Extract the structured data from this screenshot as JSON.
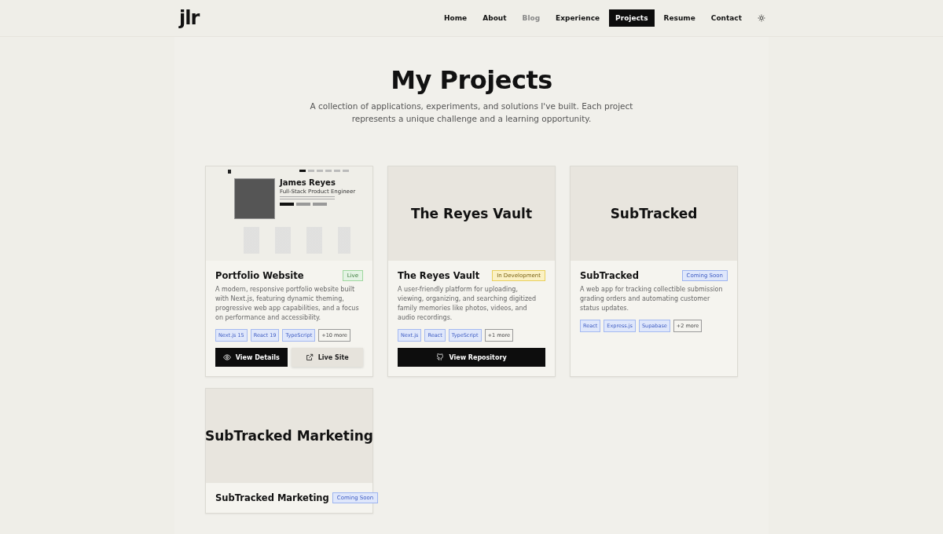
{
  "header": {
    "logo": "jlr",
    "nav": [
      {
        "label": "Home",
        "selected": false,
        "disabled": false
      },
      {
        "label": "About",
        "selected": false,
        "disabled": false
      },
      {
        "label": "Blog",
        "selected": false,
        "disabled": true
      },
      {
        "label": "Experience",
        "selected": false,
        "disabled": false
      },
      {
        "label": "Projects",
        "selected": true,
        "disabled": false
      },
      {
        "label": "Resume",
        "selected": false,
        "disabled": false
      },
      {
        "label": "Contact",
        "selected": false,
        "disabled": false
      }
    ]
  },
  "page": {
    "title": "My Projects",
    "subtitle": "A collection of applications, experiments, and solutions I've built. Each project represents a unique challenge and a learning opportunity."
  },
  "projects": [
    {
      "title": "Portfolio Website",
      "cover": {
        "kind": "screenshot",
        "heading": "James Reyes",
        "subheading": "Full-Stack Product Engineer"
      },
      "status": {
        "label": "Live",
        "kind": "live"
      },
      "description": "A modern, responsive portfolio website built with Next.js, featuring dynamic theming, progressive web app capabilities, and a focus on performance and accessibility.",
      "tags": [
        {
          "label": "Next.js 15",
          "kind": "tech"
        },
        {
          "label": "React 19",
          "kind": "tech"
        },
        {
          "label": "TypeScript",
          "kind": "tech"
        },
        {
          "label": "+10 more",
          "kind": "more"
        }
      ],
      "buttons": [
        {
          "label": "View Details",
          "kind": "details"
        },
        {
          "label": "Live Site",
          "kind": "live-site"
        }
      ]
    },
    {
      "title": "The Reyes Vault",
      "cover": {
        "kind": "title",
        "heading": "The Reyes Vault"
      },
      "status": {
        "label": "In Development",
        "kind": "development"
      },
      "description": "A user-friendly platform for uploading, viewing, organizing, and searching digitized family memories like photos, videos, and audio recordings.",
      "tags": [
        {
          "label": "Next.js",
          "kind": "tech"
        },
        {
          "label": "React",
          "kind": "tech"
        },
        {
          "label": "TypeScript",
          "kind": "tech"
        },
        {
          "label": "+1 more",
          "kind": "more"
        }
      ],
      "buttons": [
        {
          "label": "View Repository",
          "kind": "repository"
        }
      ]
    },
    {
      "title": "SubTracked",
      "cover": {
        "kind": "title",
        "heading": "SubTracked"
      },
      "status": {
        "label": "Coming Soon",
        "kind": "soon"
      },
      "description": "A web app for tracking collectible submission grading orders and automating customer status updates.",
      "tags": [
        {
          "label": "React",
          "kind": "tech"
        },
        {
          "label": "Express.js",
          "kind": "tech"
        },
        {
          "label": "Supabase",
          "kind": "tech"
        },
        {
          "label": "+2 more",
          "kind": "more"
        }
      ]
    },
    {
      "title": "SubTracked Marketing",
      "cover": {
        "kind": "title",
        "heading": "SubTracked Marketing"
      },
      "status": {
        "label": "Coming Soon",
        "kind": "soon"
      }
    }
  ]
}
